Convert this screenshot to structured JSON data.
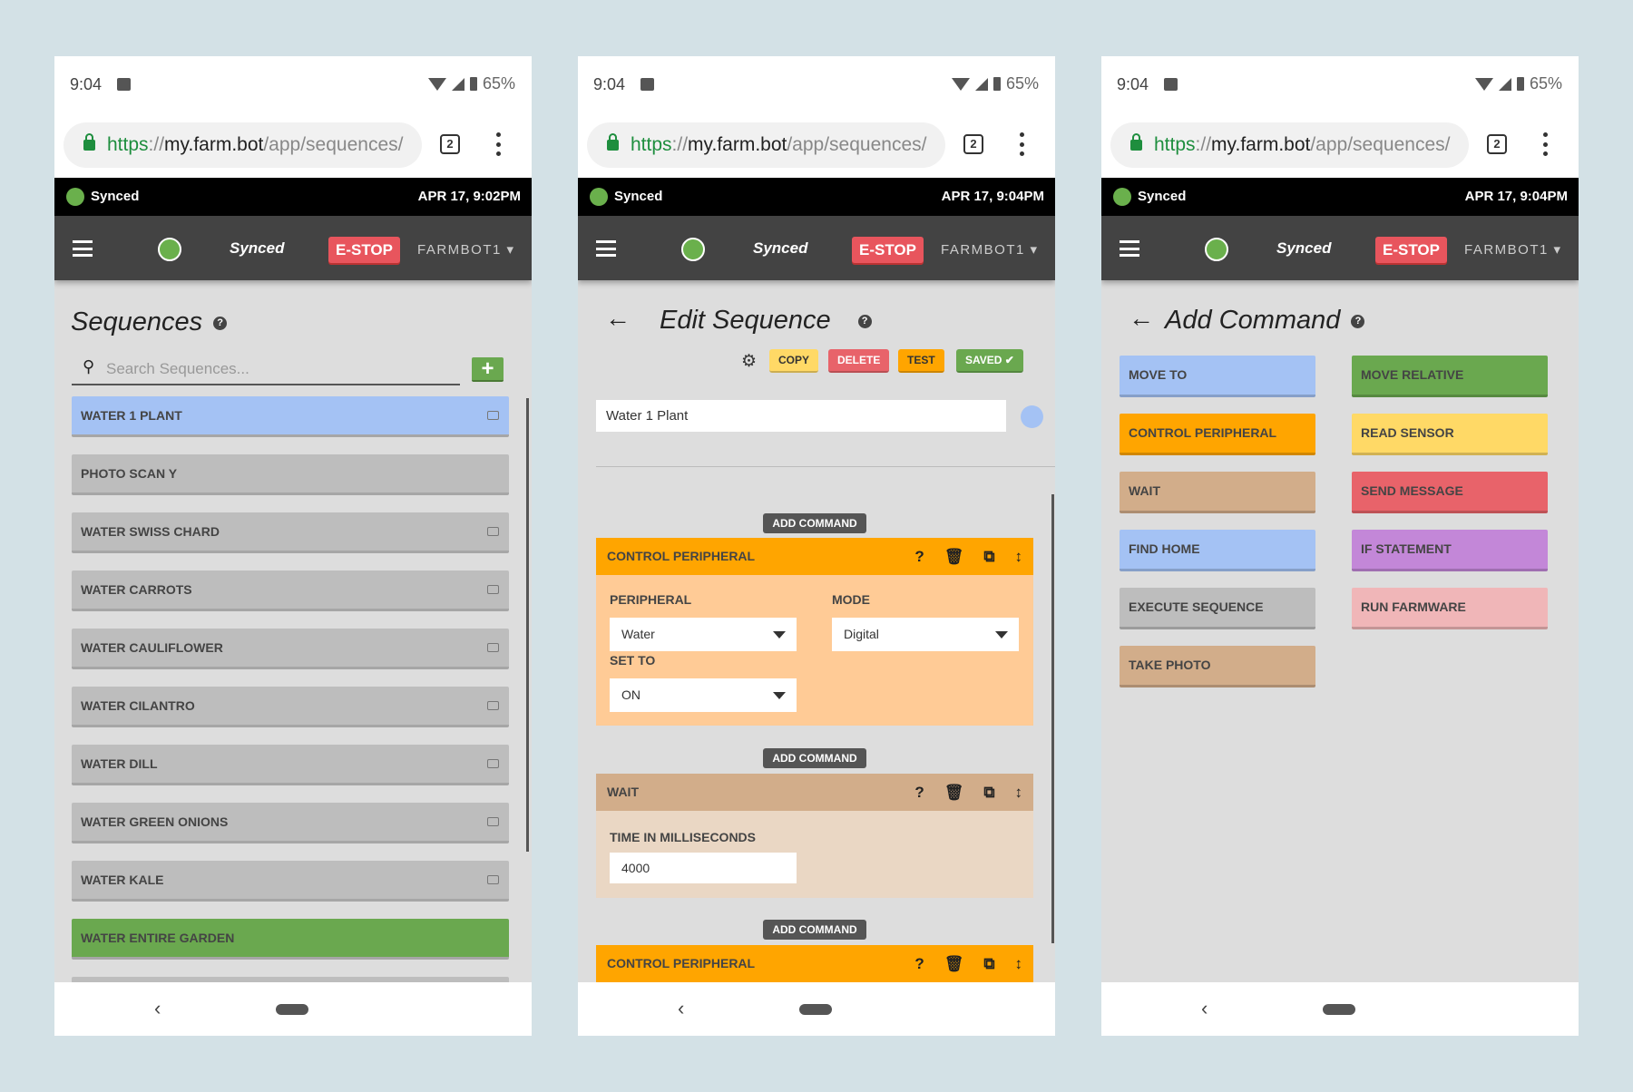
{
  "status": {
    "time": "9:04",
    "battery": "65%"
  },
  "browser": {
    "url_scheme": "https",
    "url_sep": "://",
    "url_domain": "my.farm.bot",
    "url_path": "/app/sequences/",
    "tab_count": "2"
  },
  "app": {
    "sync_label": "Synced",
    "estop": "E-STOP",
    "bot_name": "FARMBOT1 ▾"
  },
  "panels": [
    {
      "timestamp": "APR 17, 9:02PM"
    },
    {
      "timestamp": "APR 17, 9:04PM"
    },
    {
      "timestamp": "APR 17, 9:04PM"
    }
  ],
  "sequences": {
    "title": "Sequences",
    "search_placeholder": "Search Sequences...",
    "add_label": "+",
    "items": [
      {
        "label": "WATER 1 PLANT",
        "color": "#a4c2f4",
        "icon": true
      },
      {
        "label": "PHOTO SCAN Y",
        "color": "#bdbdbd",
        "icon": false
      },
      {
        "label": "WATER SWISS CHARD",
        "color": "#bdbdbd",
        "icon": true
      },
      {
        "label": "WATER CARROTS",
        "color": "#bdbdbd",
        "icon": true
      },
      {
        "label": "WATER CAULIFLOWER",
        "color": "#bdbdbd",
        "icon": true
      },
      {
        "label": "WATER CILANTRO",
        "color": "#bdbdbd",
        "icon": true
      },
      {
        "label": "WATER DILL",
        "color": "#bdbdbd",
        "icon": true
      },
      {
        "label": "WATER GREEN ONIONS",
        "color": "#bdbdbd",
        "icon": true
      },
      {
        "label": "WATER KALE",
        "color": "#bdbdbd",
        "icon": true
      },
      {
        "label": "WATER ENTIRE GARDEN",
        "color": "#6aa84f",
        "icon": false
      }
    ]
  },
  "edit": {
    "title": "Edit Sequence",
    "copy": "COPY",
    "delete": "DELETE",
    "test": "TEST",
    "saved": "SAVED ✔",
    "name_value": "Water 1 Plant",
    "add_command": "ADD COMMAND",
    "step1": {
      "title": "CONTROL PERIPHERAL",
      "peripheral_label": "PERIPHERAL",
      "peripheral_value": "Water",
      "mode_label": "MODE",
      "mode_value": "Digital",
      "set_to_label": "SET TO",
      "set_to_value": "ON"
    },
    "step2": {
      "title": "WAIT",
      "time_label": "TIME IN MILLISECONDS",
      "time_value": "4000"
    },
    "step3": {
      "title": "CONTROL PERIPHERAL"
    }
  },
  "add": {
    "title": "Add Command",
    "commands": [
      {
        "label": "MOVE TO",
        "color": "#a4c2f4"
      },
      {
        "label": "MOVE RELATIVE",
        "color": "#6aa84f"
      },
      {
        "label": "CONTROL PERIPHERAL",
        "color": "#ffa500"
      },
      {
        "label": "READ SENSOR",
        "color": "#ffd966"
      },
      {
        "label": "WAIT",
        "color": "#d2ad8a"
      },
      {
        "label": "SEND MESSAGE",
        "color": "#e8636a"
      },
      {
        "label": "FIND HOME",
        "color": "#a4c2f4"
      },
      {
        "label": "IF STATEMENT",
        "color": "#c387d8"
      },
      {
        "label": "EXECUTE SEQUENCE",
        "color": "#bdbdbd"
      },
      {
        "label": "RUN FARMWARE",
        "color": "#f0b6b8"
      },
      {
        "label": "TAKE PHOTO",
        "color": "#d2ad8a"
      }
    ]
  }
}
